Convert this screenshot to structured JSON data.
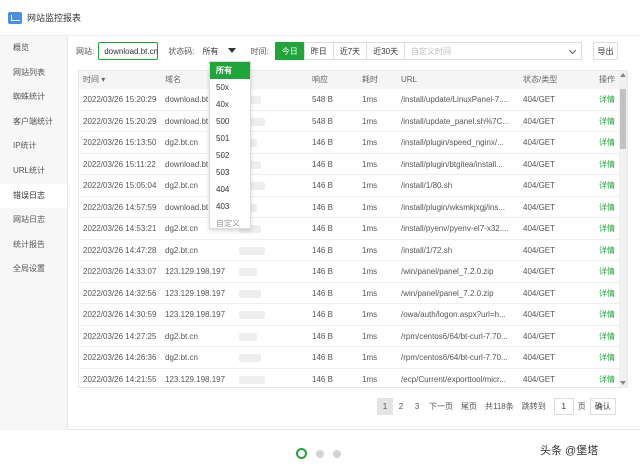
{
  "app": {
    "title": "网站监控报表"
  },
  "sidebar": {
    "items": [
      {
        "label": "概览"
      },
      {
        "label": "网站列表"
      },
      {
        "label": "蜘蛛统计"
      },
      {
        "label": "客户端统计"
      },
      {
        "label": "IP统计"
      },
      {
        "label": "URL统计"
      },
      {
        "label": "错误日志"
      },
      {
        "label": "网站日志"
      },
      {
        "label": "统计报告"
      },
      {
        "label": "全局设置"
      }
    ],
    "active_index": 6
  },
  "toolbar": {
    "site_label": "网站:",
    "site_value": "download.bt.cn",
    "status_label": "状态码:",
    "status_value": "所有",
    "time_label": "时间:",
    "time_buttons": [
      "今日",
      "昨日",
      "近7天",
      "近30天"
    ],
    "custom_time_placeholder": "自定义时间",
    "export_label": "导出"
  },
  "status_dropdown": {
    "options": [
      "所有",
      "50x",
      "40x",
      "500",
      "501",
      "502",
      "503",
      "404",
      "403",
      "自定义"
    ],
    "selected": "所有"
  },
  "table": {
    "headers": [
      "时间",
      "域名",
      "响应",
      "耗时",
      "URL",
      "状态/类型",
      "操作"
    ],
    "rows": [
      {
        "time": "2022/03/26 15:20:29",
        "domain": "download.bt.cn",
        "size": "548 B",
        "ms": "1ms",
        "url": "/install/update/LinuxPanel-7....",
        "status": "404/GET",
        "action": "详情"
      },
      {
        "time": "2022/03/26 15:20:29",
        "domain": "download.bt.cn",
        "size": "548 B",
        "ms": "1ms",
        "url": "/install/update_panel.sh%7C...",
        "status": "404/GET",
        "action": "详情"
      },
      {
        "time": "2022/03/26 15:13:50",
        "domain": "dg2.bt.cn",
        "size": "146 B",
        "ms": "1ms",
        "url": "/install/plugin/speed_nginx/...",
        "status": "404/GET",
        "action": "详情"
      },
      {
        "time": "2022/03/26 15:11:22",
        "domain": "download.bt.cn",
        "size": "146 B",
        "ms": "1ms",
        "url": "/install/plugin/btgitea/install...",
        "status": "404/GET",
        "action": "详情"
      },
      {
        "time": "2022/03/26 15:05:04",
        "domain": "dg2.bt.cn",
        "size": "146 B",
        "ms": "1ms",
        "url": "/install/1/80.sh",
        "status": "404/GET",
        "action": "详情"
      },
      {
        "time": "2022/03/26 14:57:59",
        "domain": "download.bt.cn",
        "size": "146 B",
        "ms": "1ms",
        "url": "/install/plugin/wksmkjxgj/ins...",
        "status": "404/GET",
        "action": "详情"
      },
      {
        "time": "2022/03/26 14:53:21",
        "domain": "dg2.bt.cn",
        "size": "146 B",
        "ms": "1ms",
        "url": "/install/pyenv/pyenv-el7-x32....",
        "status": "404/GET",
        "action": "详情"
      },
      {
        "time": "2022/03/26 14:47:28",
        "domain": "dg2.bt.cn",
        "size": "146 B",
        "ms": "1ms",
        "url": "/install/1/72.sh",
        "status": "404/GET",
        "action": "详情"
      },
      {
        "time": "2022/03/26 14:33:07",
        "domain": "123.129.198.197",
        "size": "146 B",
        "ms": "1ms",
        "url": "/win/panel/panel_7.2.0.zip",
        "status": "404/GET",
        "action": "详情"
      },
      {
        "time": "2022/03/26 14:32:56",
        "domain": "123.129.198.197",
        "size": "146 B",
        "ms": "1ms",
        "url": "/win/panel/panel_7.2.0.zip",
        "status": "404/GET",
        "action": "详情"
      },
      {
        "time": "2022/03/26 14:30:59",
        "domain": "123.129.198.197",
        "size": "146 B",
        "ms": "1ms",
        "url": "/owa/auth/logon.aspx?url=h...",
        "status": "404/GET",
        "action": "详情"
      },
      {
        "time": "2022/03/26 14:27:25",
        "domain": "dg2.bt.cn",
        "size": "146 B",
        "ms": "1ms",
        "url": "/rpm/centos6/64/bt-curl-7.70...",
        "status": "404/GET",
        "action": "详情"
      },
      {
        "time": "2022/03/26 14:26:36",
        "domain": "dg2.bt.cn",
        "size": "146 B",
        "ms": "1ms",
        "url": "/rpm/centos6/64/bt-curl-7.70...",
        "status": "404/GET",
        "action": "详情"
      },
      {
        "time": "2022/03/26 14:21:55",
        "domain": "123.129.198.197",
        "size": "146 B",
        "ms": "1ms",
        "url": "/ecp/Current/exporttool/micr...",
        "status": "404/GET",
        "action": "详情"
      }
    ]
  },
  "pagination": {
    "pages": [
      "1",
      "2",
      "3"
    ],
    "current": "1",
    "next_label": "下一页",
    "last_label": "尾页",
    "total_label": "共118条",
    "jump_label": "跳转到",
    "jump_value": "1",
    "page_suffix": "页",
    "confirm_label": "确认"
  },
  "carousel": {
    "count": 3,
    "active_index": 0
  },
  "watermark": "头条 @堡塔",
  "colors": {
    "accent": "#20a53a",
    "link": "#20a53a"
  }
}
